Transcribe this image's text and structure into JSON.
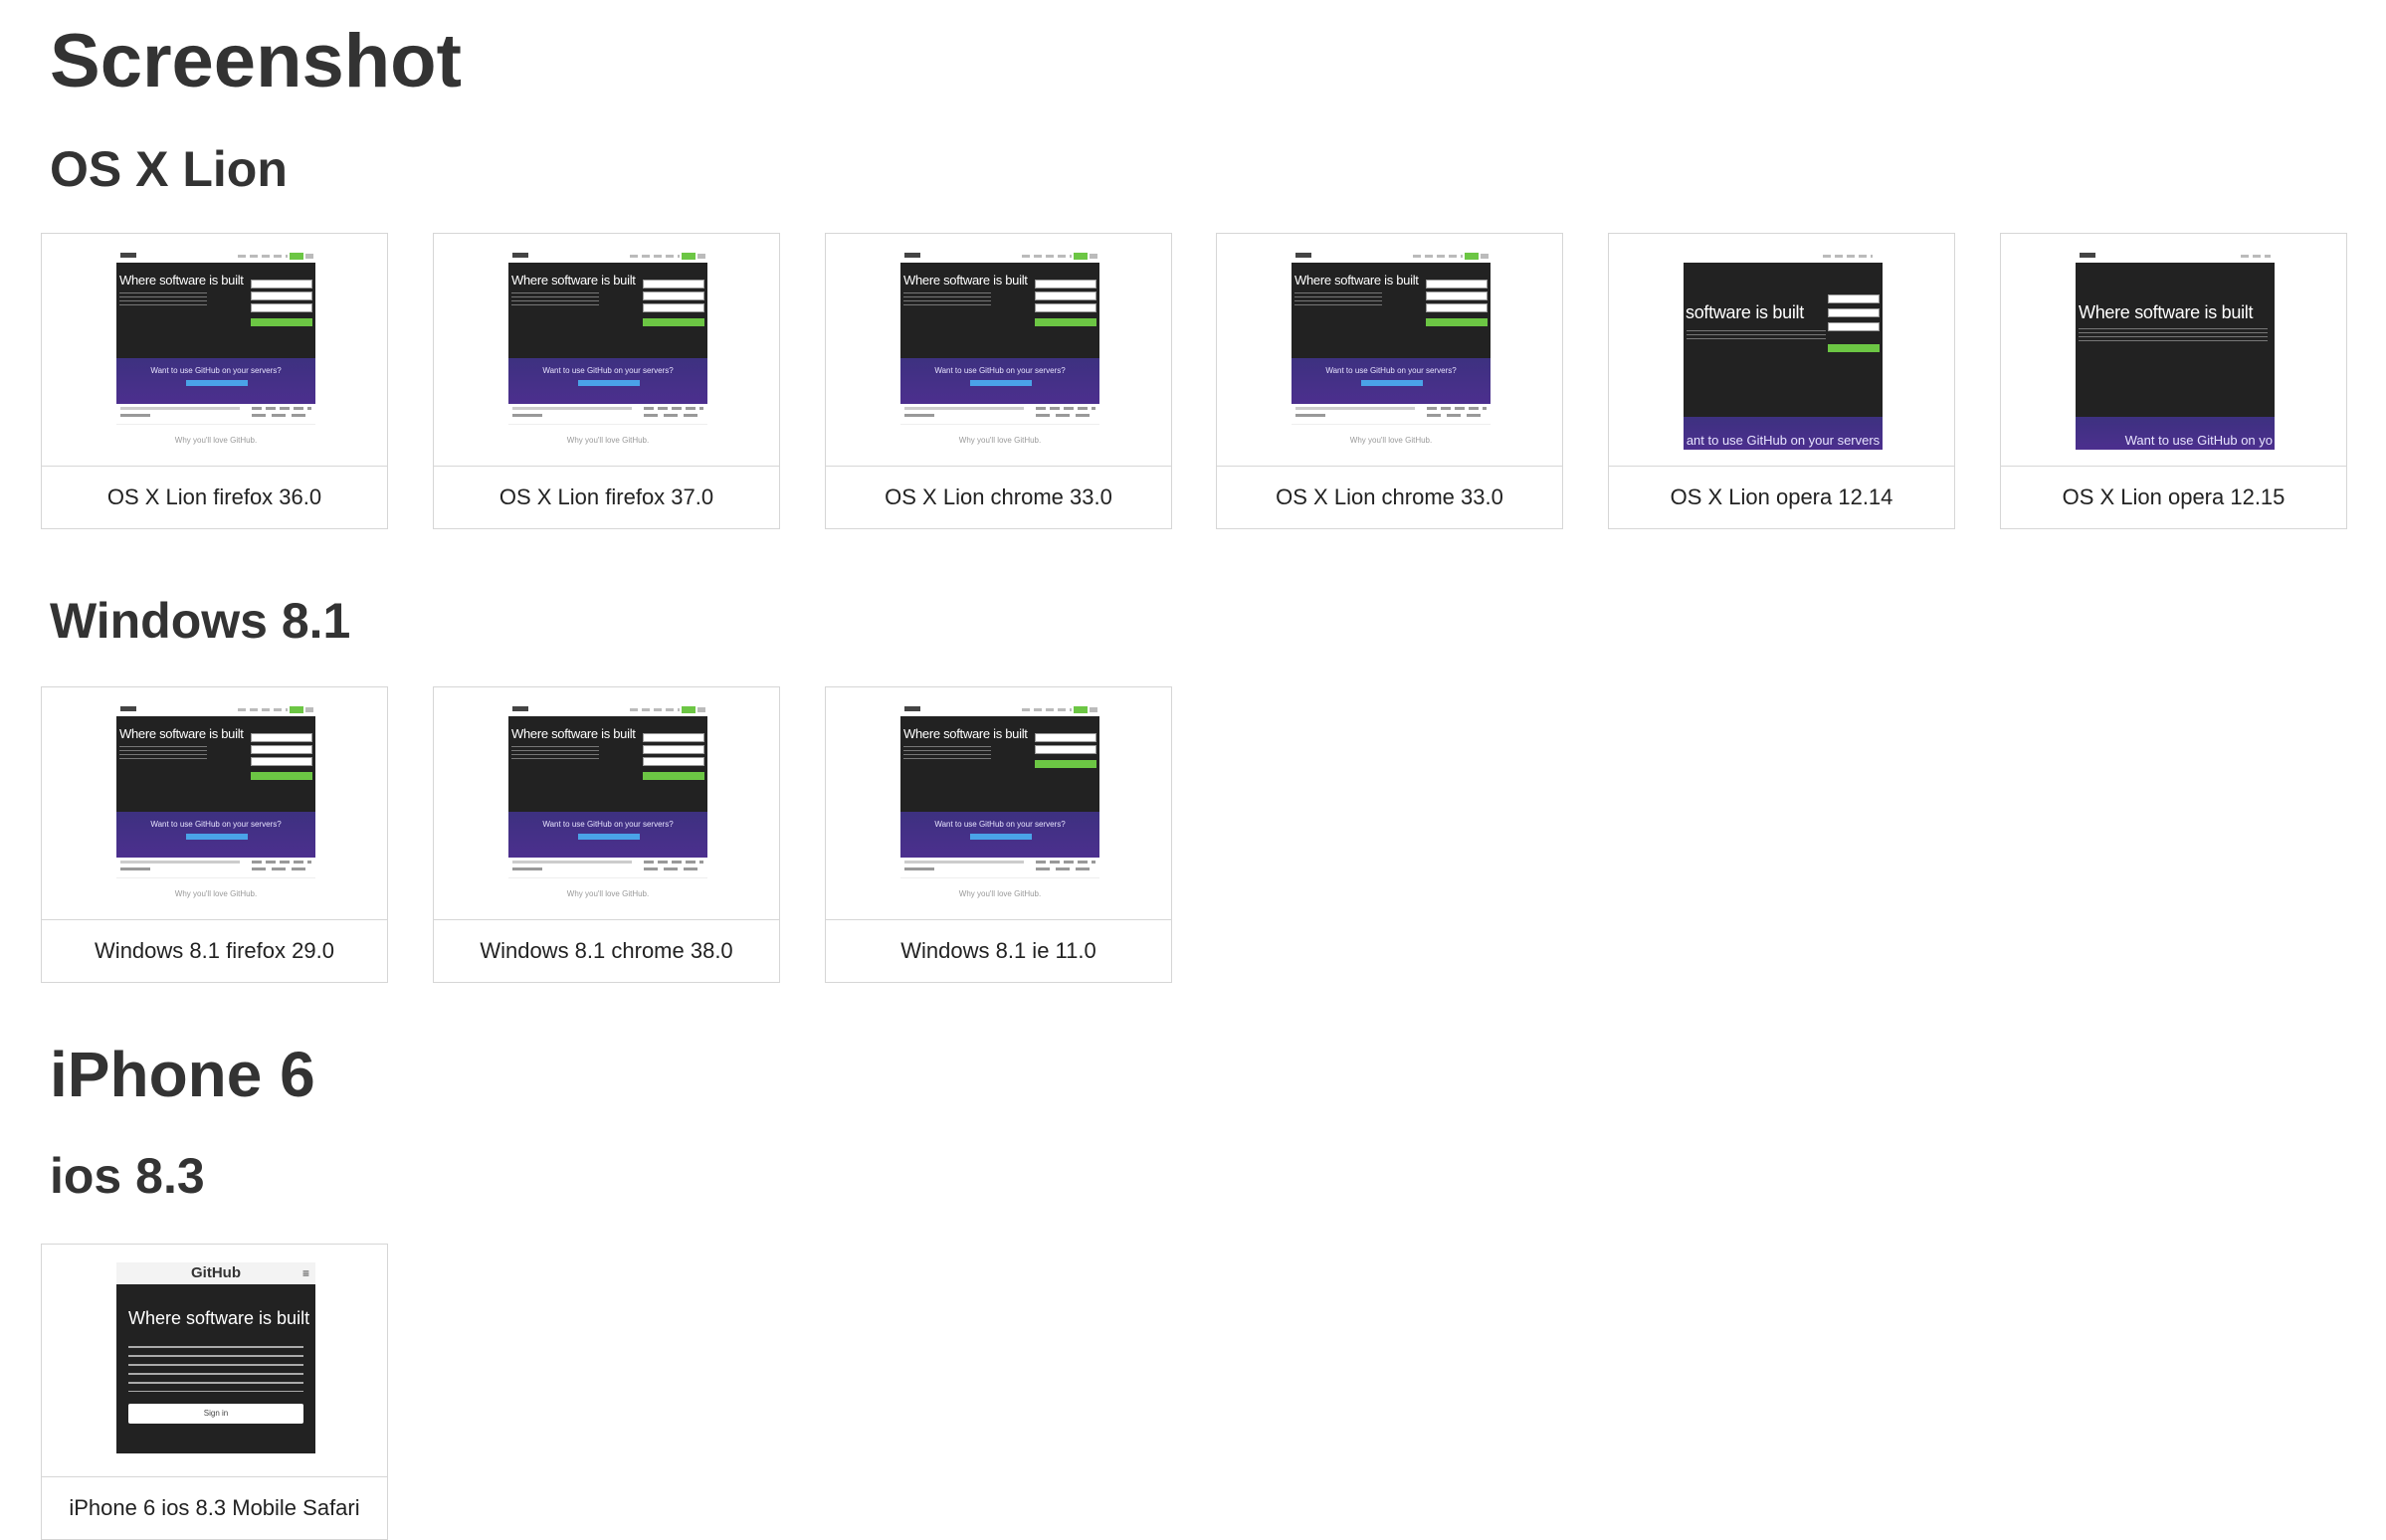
{
  "page": {
    "title": "Screenshot"
  },
  "sections": [
    {
      "device": null,
      "os": "OS X Lion",
      "items": [
        {
          "label": "OS X Lion firefox 36.0",
          "variant": "desktop"
        },
        {
          "label": "OS X Lion firefox 37.0",
          "variant": "desktop"
        },
        {
          "label": "OS X Lion chrome 33.0",
          "variant": "desktop"
        },
        {
          "label": "OS X Lion chrome 33.0",
          "variant": "desktop"
        },
        {
          "label": "OS X Lion opera 12.14",
          "variant": "opera-crop"
        },
        {
          "label": "OS X Lion opera 12.15",
          "variant": "opera"
        }
      ]
    },
    {
      "device": null,
      "os": "Windows 8.1",
      "items": [
        {
          "label": "Windows 8.1 firefox 29.0",
          "variant": "desktop"
        },
        {
          "label": "Windows 8.1 chrome 38.0",
          "variant": "desktop"
        },
        {
          "label": "Windows 8.1 ie 11.0",
          "variant": "desktop"
        }
      ]
    },
    {
      "device": "iPhone 6",
      "os": "ios 8.3",
      "items": [
        {
          "label": "iPhone 6 ios 8.3 Mobile Safari",
          "variant": "phone"
        }
      ]
    }
  ],
  "thumbnail": {
    "hero_title": "Where software is built",
    "hero_title_crop": "software is built",
    "band_text": "Want to use GitHub on your servers?",
    "band_text_crop": "ant to use GitHub on your servers",
    "band_text_opera": "Want to use GitHub on yo",
    "footer_text": "Why you'll love GitHub.",
    "phone_logo": "GitHub",
    "phone_menu": "≡",
    "phone_hero": "Where software is built",
    "phone_button": "Sign in"
  },
  "colors": {
    "accent_green": "#6cc644",
    "hero_dark": "#222222",
    "band_purple": "#3d3180",
    "text": "#333333",
    "border": "#d6d6d6"
  }
}
